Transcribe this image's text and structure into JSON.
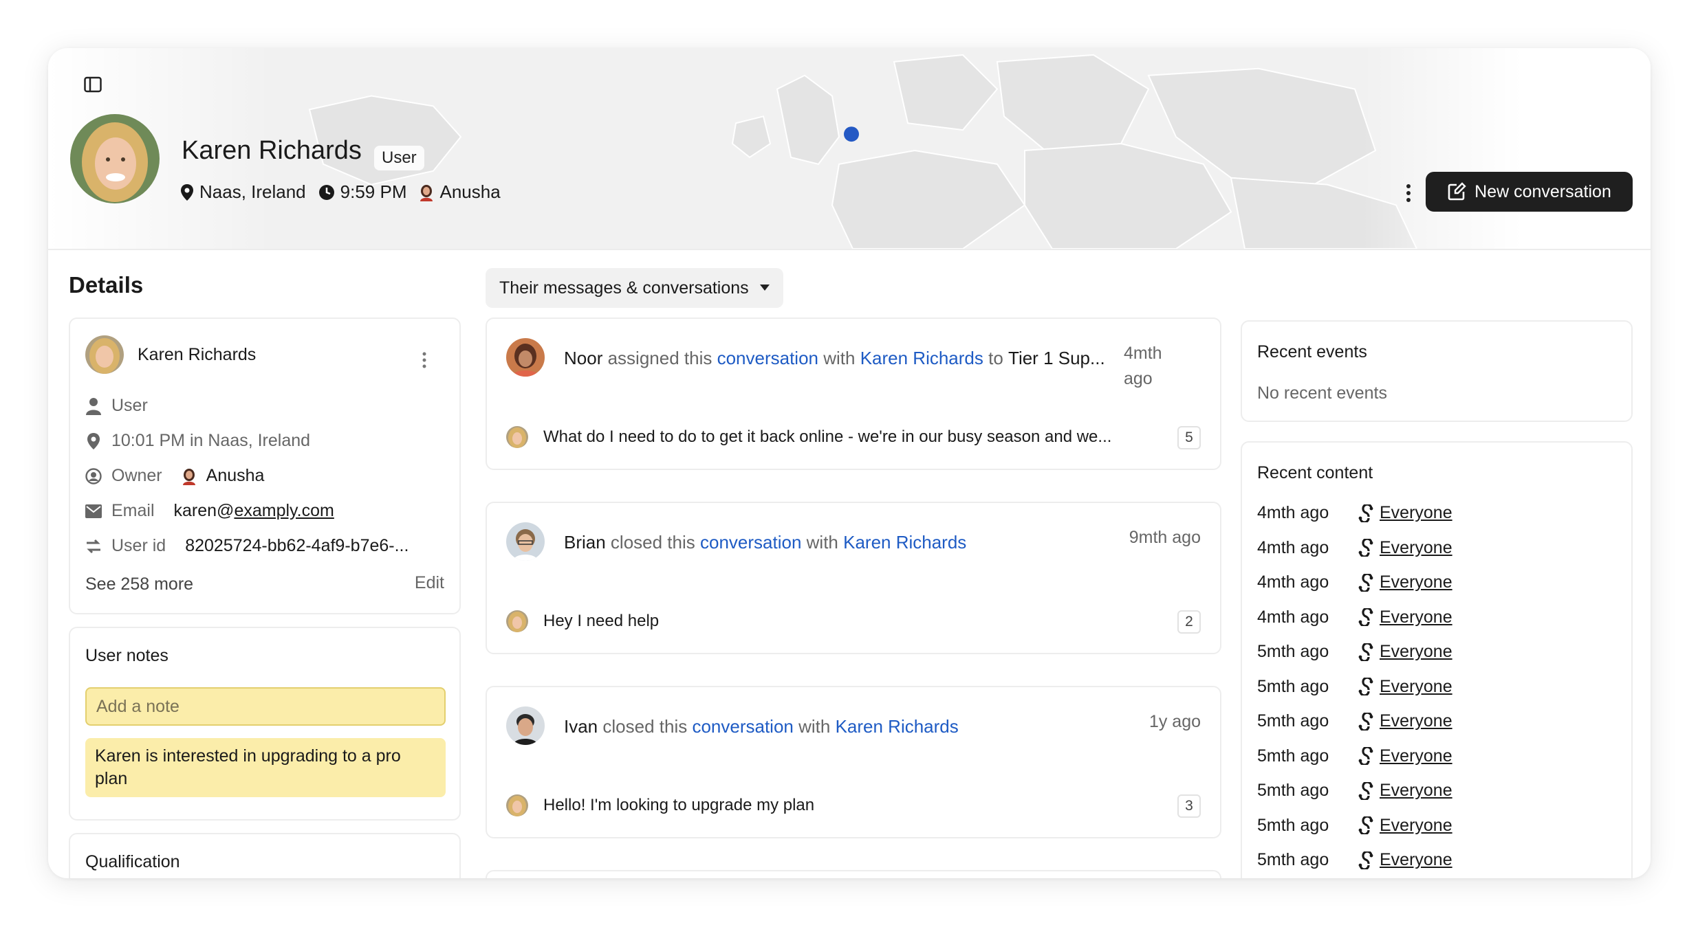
{
  "header": {
    "name": "Karen Richards",
    "role_badge": "User",
    "location": "Naas, Ireland",
    "local_time": "9:59 PM",
    "owner": "Anusha",
    "new_conversation_label": "New conversation"
  },
  "details": {
    "title": "Details",
    "card": {
      "name": "Karen Richards",
      "type": "User",
      "local_time_location": "10:01 PM in Naas, Ireland",
      "owner_label": "Owner",
      "owner": "Anusha",
      "email_label": "Email",
      "email_user": "karen@",
      "email_domain": "examply.com",
      "user_id_label": "User id",
      "user_id": "82025724-bb62-4af9-b7e6-...",
      "see_more": "See 258 more",
      "edit": "Edit"
    },
    "notes": {
      "title": "User notes",
      "placeholder": "Add a note",
      "items": [
        "Karen is interested in upgrading to a pro plan"
      ]
    },
    "qualification": {
      "title": "Qualification"
    }
  },
  "feed": {
    "filter_label": "Their messages & conversations",
    "conversations": [
      {
        "actor": "Noor",
        "action": " assigned this ",
        "object": "conversation",
        "with": " with ",
        "contact": "Karen Richards",
        "to": " to ",
        "target": "Tier 1 Sup...",
        "time_line1": "4mth",
        "time_line2": "ago",
        "snippet": "What do I need to do to get it back online - we're in our busy season and we...",
        "count": "5"
      },
      {
        "actor": "Brian",
        "action": " closed this ",
        "object": "conversation",
        "with": " with ",
        "contact": "Karen Richards",
        "time_line1": "9mth ago",
        "snippet": "Hey I need help",
        "count": "2"
      },
      {
        "actor": "Ivan",
        "action": " closed this ",
        "object": "conversation",
        "with": " with ",
        "contact": "Karen Richards",
        "time_line1": "1y ago",
        "snippet": "Hello! I'm looking to upgrade my plan",
        "count": "3"
      }
    ]
  },
  "recent_events": {
    "title": "Recent events",
    "empty": "No recent events"
  },
  "recent_content": {
    "title": "Recent content",
    "items": [
      {
        "when": "4mth ago",
        "audience": "Everyone"
      },
      {
        "when": "4mth ago",
        "audience": "Everyone"
      },
      {
        "when": "4mth ago",
        "audience": "Everyone"
      },
      {
        "when": "4mth ago",
        "audience": "Everyone"
      },
      {
        "when": "5mth ago",
        "audience": "Everyone"
      },
      {
        "when": "5mth ago",
        "audience": "Everyone"
      },
      {
        "when": "5mth ago",
        "audience": "Everyone"
      },
      {
        "when": "5mth ago",
        "audience": "Everyone"
      },
      {
        "when": "5mth ago",
        "audience": "Everyone"
      },
      {
        "when": "5mth ago",
        "audience": "Everyone"
      },
      {
        "when": "5mth ago",
        "audience": "Everyone"
      }
    ]
  },
  "colors": {
    "link": "#1e5bc4",
    "map_dot": "#2459c4",
    "note_bg": "#fbedaa",
    "button_dark": "#1f1f1f"
  }
}
